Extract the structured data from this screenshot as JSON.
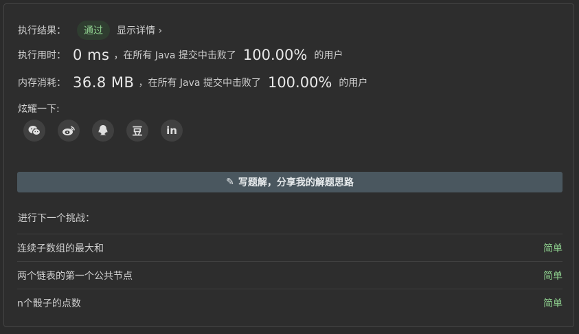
{
  "result": {
    "label": "执行结果：",
    "status": "通过",
    "detail_link": "显示详情 ›"
  },
  "runtime": {
    "label": "执行用时：",
    "value": "0 ms",
    "middle": "，在所有 Java 提交中击败了",
    "percent": "100.00%",
    "suffix": "的用户"
  },
  "memory": {
    "label": "内存消耗：",
    "value": "36.8 MB",
    "middle": "，在所有 Java 提交中击败了",
    "percent": "100.00%",
    "suffix": "的用户"
  },
  "share": {
    "label": "炫耀一下:",
    "icons": [
      "wechat-icon",
      "weibo-icon",
      "qq-icon",
      "douban-icon",
      "linkedin-icon"
    ],
    "douban_glyph": "豆",
    "linkedin_glyph": "in"
  },
  "write_solution": {
    "label": "写题解，分享我的解题思路"
  },
  "next": {
    "label": "进行下一个挑战：",
    "problems": [
      {
        "title": "连续子数组的最大和",
        "difficulty": "简单"
      },
      {
        "title": "两个链表的第一个公共节点",
        "difficulty": "简单"
      },
      {
        "title": "n个骰子的点数",
        "difficulty": "简单"
      }
    ]
  },
  "colors": {
    "background": "#2b2b2b",
    "success": "#8fd18f",
    "button": "#4a575f"
  }
}
